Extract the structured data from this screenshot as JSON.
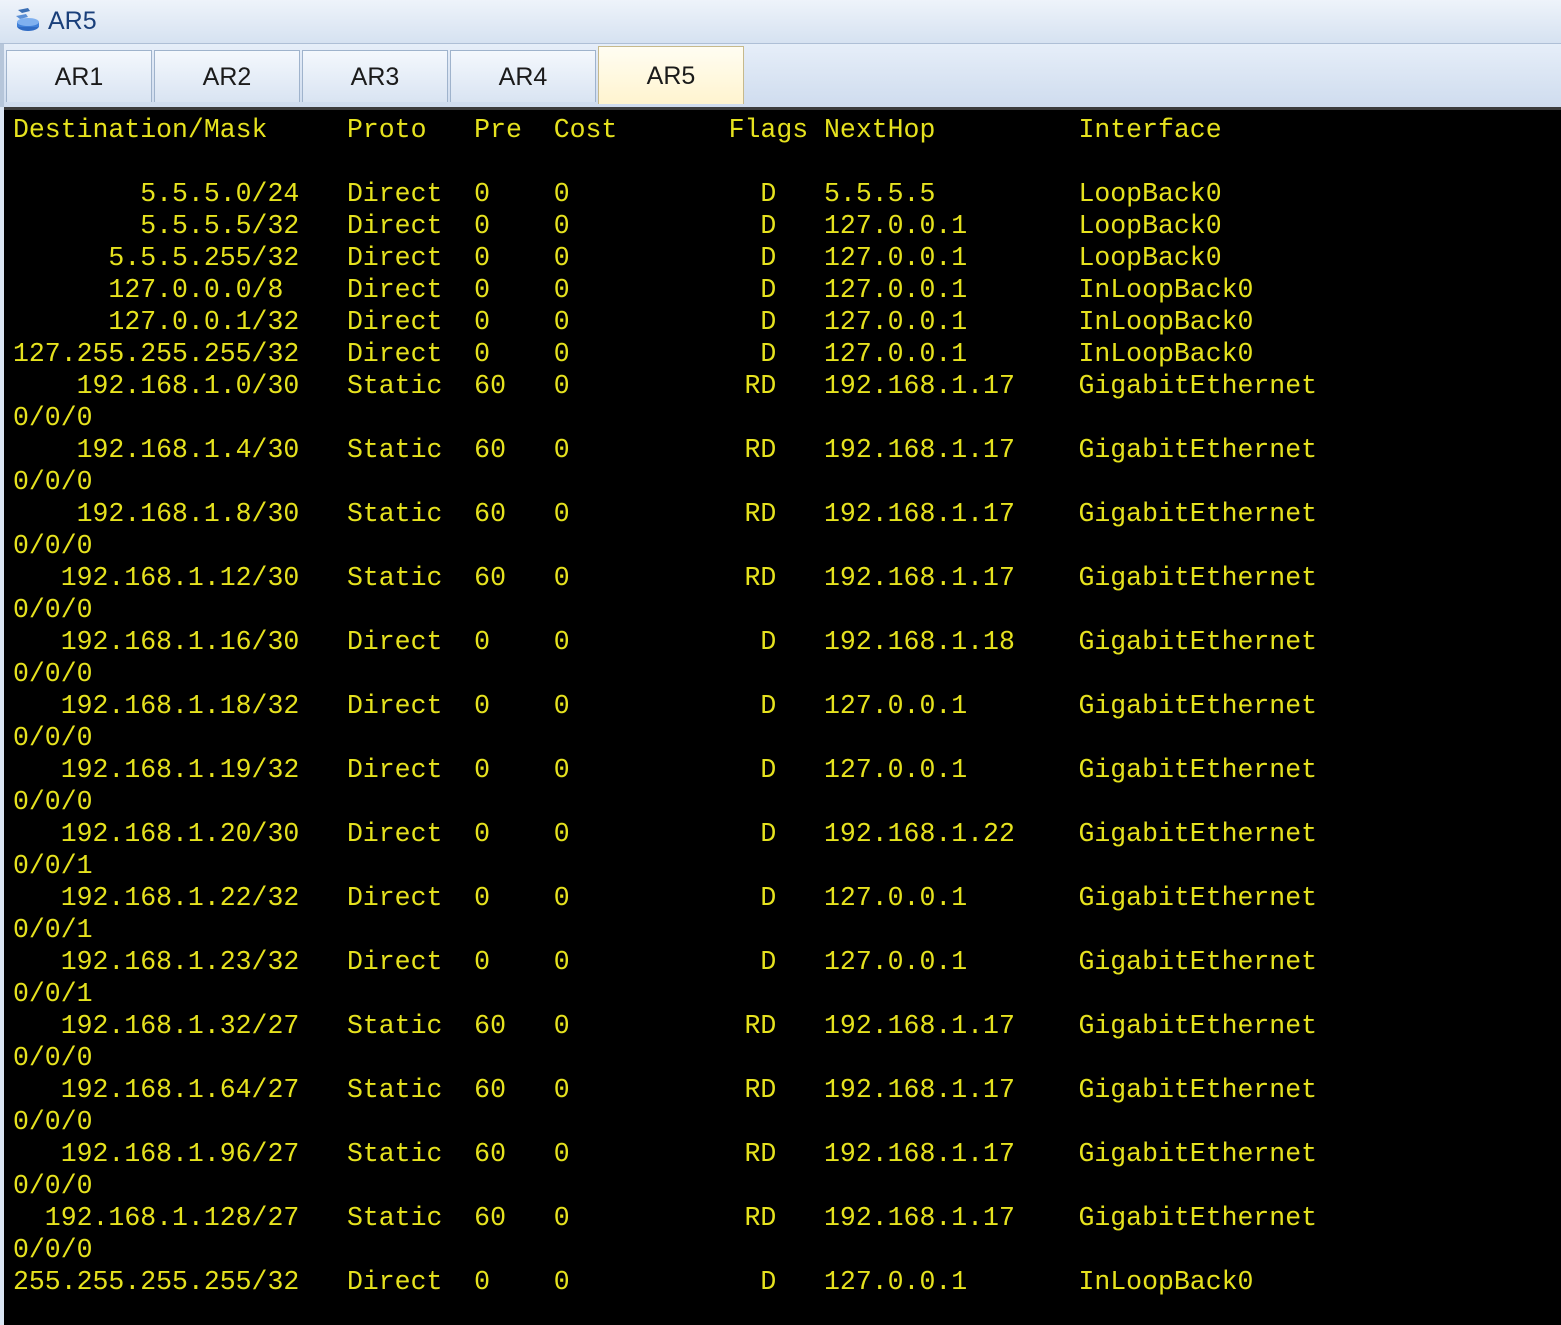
{
  "window": {
    "title": "AR5",
    "icon": "router-icon"
  },
  "tabs": [
    {
      "label": "AR1",
      "active": false
    },
    {
      "label": "AR2",
      "active": false
    },
    {
      "label": "AR3",
      "active": false
    },
    {
      "label": "AR4",
      "active": false
    },
    {
      "label": "AR5",
      "active": true
    }
  ],
  "terminal": {
    "text_color": "#e6e21e",
    "background": "#000000",
    "lines": [
      "Destination/Mask     Proto   Pre  Cost       Flags NextHop         Interface",
      "",
      "        5.5.5.0/24   Direct  0    0            D   5.5.5.5         LoopBack0",
      "        5.5.5.5/32   Direct  0    0            D   127.0.0.1       LoopBack0",
      "      5.5.5.255/32   Direct  0    0            D   127.0.0.1       LoopBack0",
      "      127.0.0.0/8    Direct  0    0            D   127.0.0.1       InLoopBack0",
      "      127.0.0.1/32   Direct  0    0            D   127.0.0.1       InLoopBack0",
      "127.255.255.255/32   Direct  0    0            D   127.0.0.1       InLoopBack0",
      "    192.168.1.0/30   Static  60   0           RD   192.168.1.17    GigabitEthernet",
      "0/0/0",
      "    192.168.1.4/30   Static  60   0           RD   192.168.1.17    GigabitEthernet",
      "0/0/0",
      "    192.168.1.8/30   Static  60   0           RD   192.168.1.17    GigabitEthernet",
      "0/0/0",
      "   192.168.1.12/30   Static  60   0           RD   192.168.1.17    GigabitEthernet",
      "0/0/0",
      "   192.168.1.16/30   Direct  0    0            D   192.168.1.18    GigabitEthernet",
      "0/0/0",
      "   192.168.1.18/32   Direct  0    0            D   127.0.0.1       GigabitEthernet",
      "0/0/0",
      "   192.168.1.19/32   Direct  0    0            D   127.0.0.1       GigabitEthernet",
      "0/0/0",
      "   192.168.1.20/30   Direct  0    0            D   192.168.1.22    GigabitEthernet",
      "0/0/1",
      "   192.168.1.22/32   Direct  0    0            D   127.0.0.1       GigabitEthernet",
      "0/0/1",
      "   192.168.1.23/32   Direct  0    0            D   127.0.0.1       GigabitEthernet",
      "0/0/1",
      "   192.168.1.32/27   Static  60   0           RD   192.168.1.17    GigabitEthernet",
      "0/0/0",
      "   192.168.1.64/27   Static  60   0           RD   192.168.1.17    GigabitEthernet",
      "0/0/0",
      "   192.168.1.96/27   Static  60   0           RD   192.168.1.17    GigabitEthernet",
      "0/0/0",
      "  192.168.1.128/27   Static  60   0           RD   192.168.1.17    GigabitEthernet",
      "0/0/0",
      "255.255.255.255/32   Direct  0    0            D   127.0.0.1       InLoopBack0"
    ]
  }
}
